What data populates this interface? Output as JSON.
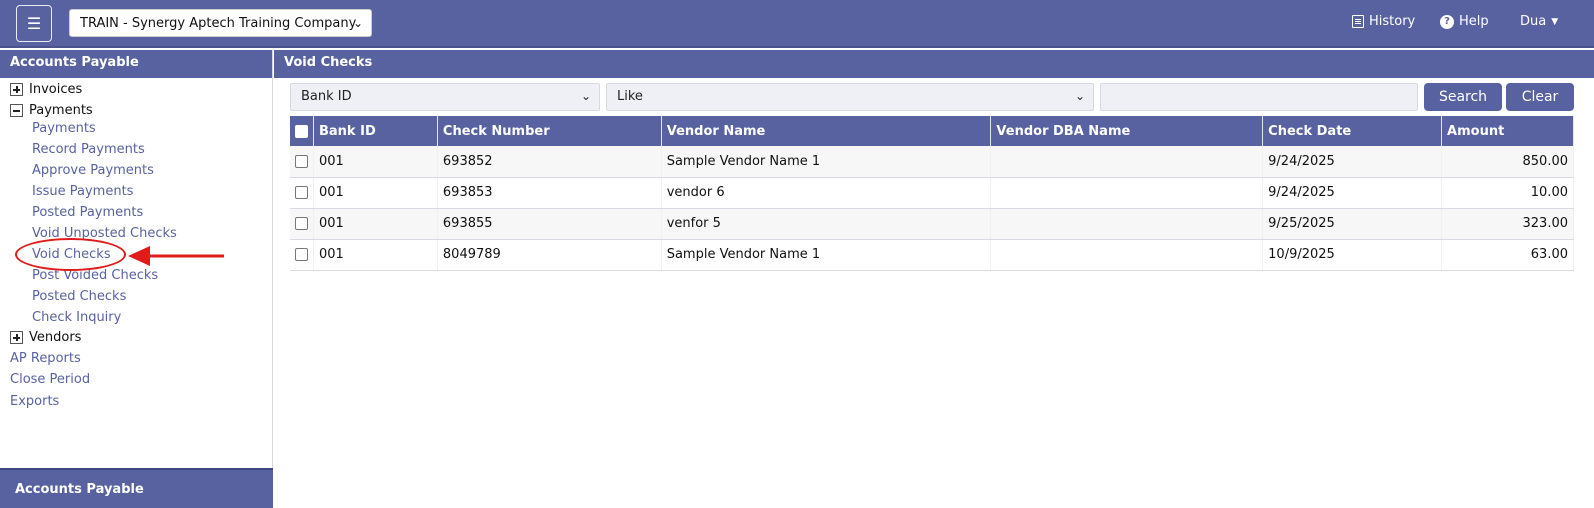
{
  "topbar": {
    "menu_icon": "hamburger-icon",
    "company": "TRAIN - Synergy Aptech Training Company",
    "history_label": "History",
    "help_label": "Help",
    "user_label": "Dua"
  },
  "sidebar": {
    "title": "Accounts Payable",
    "invoices_label": "Invoices",
    "payments_label": "Payments",
    "payments_items": [
      "Payments",
      "Record Payments",
      "Approve Payments",
      "Issue Payments",
      "Posted Payments",
      "Void Unposted Checks",
      "Void Checks",
      "Post Voided Checks",
      "Posted Checks",
      "Check Inquiry"
    ],
    "vendors_label": "Vendors",
    "ap_reports": "AP Reports",
    "close_period": "Close Period",
    "exports": "Exports",
    "footer": "Accounts Payable"
  },
  "main": {
    "title": "Void Checks",
    "filter_field": "Bank ID",
    "filter_operator": "Like",
    "filter_value": "",
    "search_label": "Search",
    "clear_label": "Clear"
  },
  "table": {
    "columns": [
      "Bank ID",
      "Check Number",
      "Vendor Name",
      "Vendor DBA Name",
      "Check Date",
      "Amount"
    ],
    "rows": [
      {
        "bank_id": "001",
        "check_number": "693852",
        "vendor_name": "Sample Vendor Name 1",
        "vendor_dba": "",
        "check_date": "9/24/2025",
        "amount": "850.00"
      },
      {
        "bank_id": "001",
        "check_number": "693853",
        "vendor_name": "vendor 6",
        "vendor_dba": "",
        "check_date": "9/24/2025",
        "amount": "10.00"
      },
      {
        "bank_id": "001",
        "check_number": "693855",
        "vendor_name": "venfor 5",
        "vendor_dba": "",
        "check_date": "9/25/2025",
        "amount": "323.00"
      },
      {
        "bank_id": "001",
        "check_number": "8049789",
        "vendor_name": "Sample Vendor Name 1",
        "vendor_dba": "",
        "check_date": "10/9/2025",
        "amount": "63.00"
      }
    ]
  },
  "colors": {
    "brand": "#5962a0",
    "annotation": "#e01b1b"
  }
}
